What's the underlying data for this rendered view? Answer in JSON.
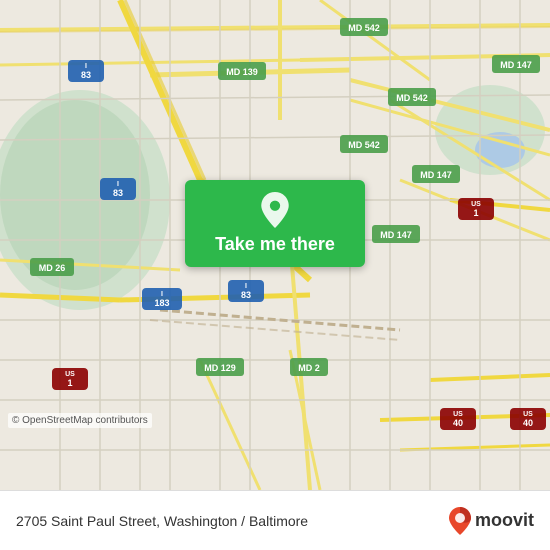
{
  "map": {
    "background_color": "#e8ddd0",
    "center_lat": 39.33,
    "center_lon": -76.62
  },
  "button": {
    "label": "Take me there",
    "background_color": "#2db84b",
    "text_color": "#ffffff"
  },
  "info_bar": {
    "address": "2705 Saint Paul Street, Washington / Baltimore",
    "background": "#ffffff",
    "osm_credit": "© OpenStreetMap contributors"
  },
  "moovit": {
    "brand_name": "moovit",
    "pin_color_top": "#e8472a",
    "pin_color_bottom": "#c0392b"
  }
}
